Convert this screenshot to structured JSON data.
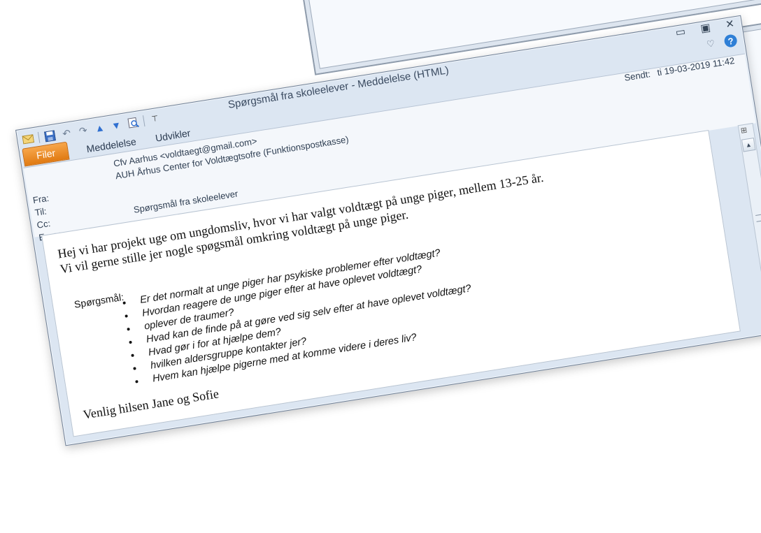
{
  "window": {
    "title": "Spørgsmål fra skoleelever  -  Meddelelse (HTML)",
    "controls": {
      "minimize": "▭",
      "maximize": "▣",
      "close": "✕"
    },
    "help_label": "?",
    "ribbon_toggle": "♡"
  },
  "quick_access": {
    "icons": [
      "mail-icon",
      "save-icon",
      "undo-icon",
      "redo-icon",
      "up-arrow-icon",
      "down-arrow-icon",
      "print-preview-icon",
      "customize-icon"
    ],
    "separator": "|",
    "customize_label": "⊤"
  },
  "tabs": [
    "Filer",
    "Meddelelse",
    "Udvikler"
  ],
  "header": {
    "from_label": "Fra:",
    "to_label": "Til:",
    "cc_label": "Cc:",
    "subject_label": "Emne:",
    "from_value": "Cfv Aarhus <voldtaegt@gmail.com>",
    "to_value": "AUH Århus Center for Voldtægtsofre (Funktionspostkasse)",
    "subject_value": "Spørgsmål fra skoleelever",
    "sent_label": "Sendt:",
    "sent_value": "ti 19-03-2019 11:42"
  },
  "message": {
    "greeting_line1": "Hej vi har projekt uge om ungdomsliv, hvor vi har valgt voldtægt på unge piger, mellem 13-25 år.",
    "greeting_line2": "Vi vil gerne stille jer nogle spøgsmål omkring voldtægt på unge piger.",
    "questions_label": "Spørgsmål:",
    "questions": [
      "Er det normalt at unge piger har psykiske problemer efter voldtægt?",
      "Hvordan reagere de unge piger efter at have oplevet voldtægt?",
      "oplever de traumer?",
      "Hvad kan de finde på at gøre ved sig selv efter at have oplevet voldtægt?",
      "Hvad gør i for at hjælpe dem?",
      "hvilken aldersgruppe kontakter jer?",
      "Hvem kan hjælpe pigerne med at komme videre i deres liv?"
    ],
    "signature": "Venlig hilsen Jane og Sofie"
  },
  "scrollbar": {
    "up": "▲",
    "down": "▼"
  },
  "colors": {
    "file_tab": "#e98a1f",
    "help": "#2f7fd6",
    "frame": "#dce6f2"
  }
}
